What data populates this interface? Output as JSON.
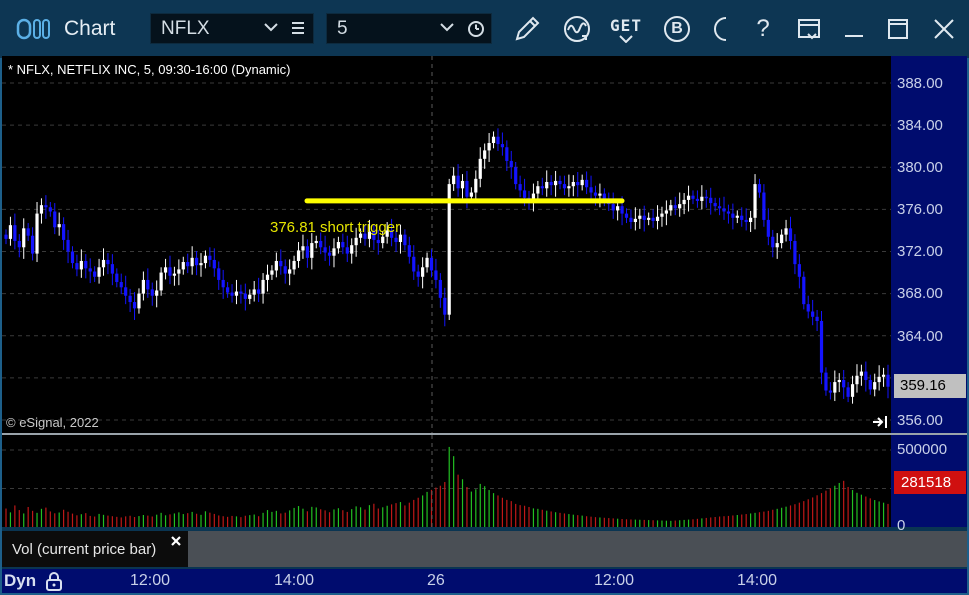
{
  "window": {
    "title": "Chart",
    "symbol_value": "NFLX",
    "interval_value": "5",
    "toolbar_icons": [
      "drawing-pencil-icon",
      "study-wave-icon",
      "get-data-icon",
      "b-icon",
      "moon-icon",
      "help-icon",
      "layout-icon",
      "minimize-icon",
      "maximize-icon",
      "close-icon"
    ],
    "get_label": "GET",
    "b_label": "B",
    "help_label": "?"
  },
  "chart": {
    "header": "* NFLX, NETFLIX INC, 5, 09:30-16:00 (Dynamic)",
    "annotation": "376.81 short trigger",
    "watermark": "© eSignal, 2022",
    "last_price": "359.16",
    "price_labels": [
      "388.00",
      "384.00",
      "380.00",
      "376.00",
      "372.00",
      "368.00",
      "364.00",
      "356.00"
    ],
    "trigger_level": 376.81,
    "colors": {
      "up": "#ffffff",
      "down": "#1414ff",
      "trigger": "#ffff00",
      "background": "#000000",
      "axis": "#000c6e"
    }
  },
  "volume": {
    "labels": [
      "500000",
      "0"
    ],
    "last_volume": "281518",
    "legend": "Vol (current price bar)"
  },
  "time_axis": {
    "mode": "Dyn",
    "labels": [
      "12:00",
      "14:00",
      "26",
      "12:00",
      "14:00"
    ]
  },
  "chart_data": {
    "type": "candlestick",
    "title": "* NFLX, NETFLIX INC, 5, 09:30-16:00 (Dynamic)",
    "ylim": [
      355,
      391
    ],
    "y_ticks": [
      356,
      360,
      364,
      368,
      372,
      376,
      380,
      384,
      388
    ],
    "last_price": 359.16,
    "x_ticks": [
      "12:00",
      "14:00",
      "26",
      "12:00",
      "14:00"
    ],
    "series": [
      {
        "name": "NFLX",
        "close": [
          373.2,
          374.5,
          373.0,
          372.4,
          374.2,
          373.5,
          371.8,
          375.6,
          376.4,
          376.2,
          375.8,
          374.3,
          374.6,
          373.1,
          372.0,
          370.9,
          370.3,
          371.1,
          370.4,
          370.1,
          369.6,
          370.5,
          371.2,
          370.8,
          369.9,
          369.1,
          368.6,
          367.8,
          367.2,
          366.6,
          368.0,
          369.3,
          368.4,
          367.8,
          368.3,
          370.0,
          370.5,
          369.7,
          369.9,
          370.3,
          371.0,
          370.6,
          371.4,
          370.7,
          370.9,
          371.6,
          371.2,
          370.4,
          369.3,
          368.6,
          368.1,
          367.8,
          368.2,
          368.0,
          367.5,
          367.9,
          368.4,
          368.0,
          369.3,
          369.8,
          370.2,
          371.1,
          370.6,
          369.9,
          370.3,
          371.1,
          372.1,
          372.5,
          371.4,
          372.8,
          373.0,
          372.4,
          371.9,
          371.6,
          372.3,
          372.9,
          372.4,
          371.8,
          372.6,
          373.3,
          373.7,
          373.2,
          373.9,
          373.1,
          372.8,
          373.4,
          374.0,
          373.3,
          372.9,
          373.6,
          372.6,
          371.5,
          370.1,
          369.6,
          370.5,
          371.4,
          370.2,
          369.3,
          367.6,
          366.0,
          378.4,
          379.2,
          378.0,
          378.7,
          377.2,
          377.6,
          378.9,
          380.8,
          381.6,
          382.3,
          382.9,
          382.2,
          381.9,
          380.6,
          380.0,
          378.4,
          377.8,
          377.1,
          376.9,
          377.5,
          378.2,
          378.0,
          378.6,
          378.3,
          378.7,
          378.4,
          378.0,
          378.2,
          378.6,
          378.3,
          378.8,
          378.1,
          377.6,
          377.3,
          377.5,
          376.8,
          376.5,
          375.9,
          376.3,
          375.6,
          375.2,
          374.8,
          375.1,
          375.4,
          375.0,
          375.2,
          374.9,
          375.3,
          375.6,
          375.9,
          376.4,
          376.1,
          376.5,
          376.9,
          377.3,
          377.0,
          376.8,
          377.2,
          377.1,
          376.6,
          376.3,
          376.1,
          375.8,
          375.6,
          375.2,
          375.4,
          375.0,
          374.8,
          375.2,
          378.4,
          377.6,
          375.0,
          373.4,
          372.4,
          372.8,
          373.6,
          374.2,
          373.0,
          370.8,
          369.6,
          367.0,
          366.3,
          365.8,
          365.4,
          360.5,
          358.8,
          358.6,
          359.6,
          359.8,
          359.1,
          358.2,
          359.4,
          360.2,
          360.6,
          359.8,
          358.9,
          359.6,
          360.1,
          360.3,
          359.16
        ],
        "volume": [
          120000,
          95000,
          140000,
          110000,
          88000,
          130000,
          105000,
          92000,
          118000,
          126000,
          101000,
          89000,
          94000,
          112000,
          99000,
          87000,
          76000,
          83000,
          90000,
          72000,
          68000,
          85000,
          79000,
          74000,
          70000,
          66000,
          62000,
          69000,
          73000,
          65000,
          71000,
          78000,
          74000,
          68000,
          80000,
          92000,
          76000,
          82000,
          88000,
          95000,
          84000,
          90000,
          98000,
          86000,
          79000,
          102000,
          93000,
          85000,
          75000,
          70000,
          66000,
          72000,
          69000,
          64000,
          73000,
          77000,
          81000,
          70000,
          92000,
          110000,
          98000,
          105000,
          88000,
          93000,
          108000,
          124000,
          136000,
          119000,
          102000,
          131000,
          127000,
          115000,
          108000,
          96000,
          114000,
          122000,
          109000,
          98000,
          116000,
          134000,
          128000,
          113000,
          142000,
          151000,
          120000,
          128000,
          138000,
          147000,
          155000,
          162000,
          140000,
          158000,
          176000,
          190000,
          205000,
          228000,
          241000,
          256000,
          268000,
          292000,
          520000,
          460000,
          340000,
          310000,
          260000,
          230000,
          245000,
          280000,
          265000,
          240000,
          220000,
          205000,
          190000,
          176000,
          168000,
          150000,
          142000,
          138000,
          130000,
          121000,
          118000,
          112000,
          106000,
          101000,
          96000,
          92000,
          88000,
          84000,
          80000,
          77000,
          74000,
          70000,
          67000,
          64000,
          62000,
          60000,
          58000,
          56000,
          54000,
          52000,
          50000,
          49000,
          48000,
          47000,
          46000,
          45000,
          44000,
          43000,
          42000,
          41000,
          40000,
          42000,
          44000,
          46000,
          48000,
          50000,
          53000,
          56000,
          59000,
          62000,
          65000,
          68000,
          70000,
          72000,
          75000,
          78000,
          81000,
          84000,
          88000,
          92000,
          96000,
          100000,
          105000,
          112000,
          118000,
          125000,
          132000,
          140000,
          148000,
          158000,
          168000,
          180000,
          192000,
          206000,
          220000,
          236000,
          252000,
          268000,
          286000,
          300000,
          260000,
          240000,
          222000,
          210000,
          198000,
          186000,
          175000,
          166000,
          158000,
          150000,
          162000,
          174000,
          190000,
          210000,
          281518
        ]
      }
    ]
  }
}
